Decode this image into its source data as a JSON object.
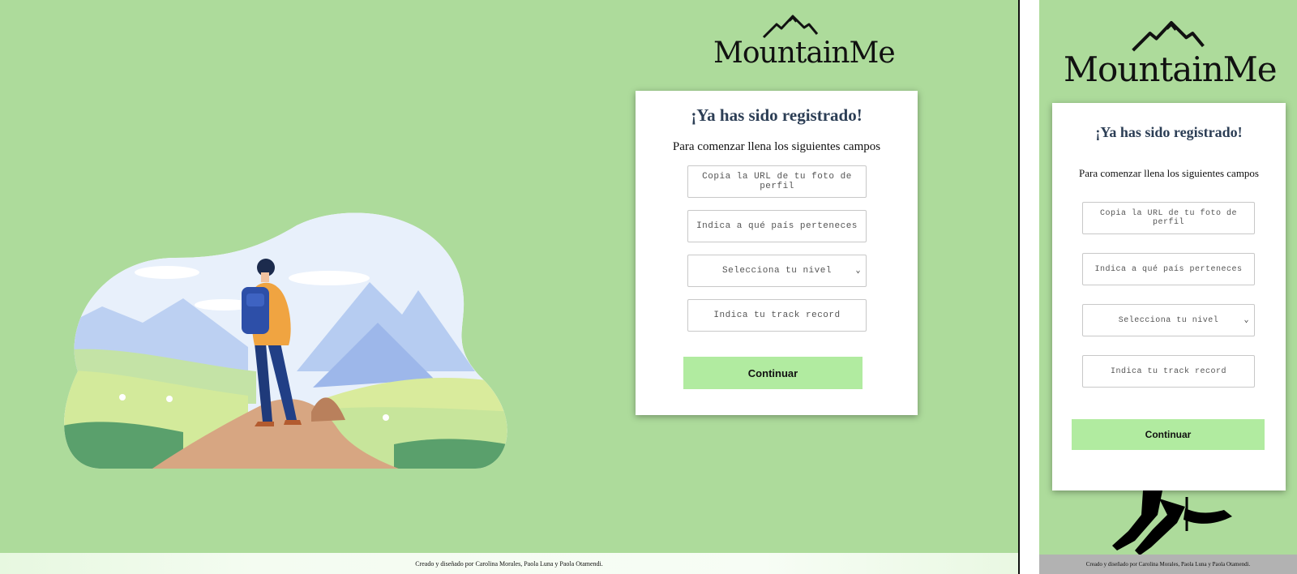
{
  "brand": {
    "name": "MountainMe",
    "logo_icon": "mountain-peaks-icon"
  },
  "card": {
    "title": "¡Ya has sido registrado!",
    "subtitle": "Para comenzar llena los siguientes campos",
    "fields": {
      "photo_url_placeholder": "Copia la URL de tu foto de perfil",
      "country_placeholder": "Indica a qué país perteneces",
      "level_selected": "Selecciona tu nivel",
      "track_record_placeholder": "Indica tu track record"
    },
    "continue_label": "Continuar"
  },
  "footer": {
    "credits": "Creado y diseñado por Carolina Morales, Paola Luna y Paola Otamendi."
  },
  "colors": {
    "background": "#addb9b",
    "button": "#b1eba0",
    "title": "#2c3e55",
    "mobile_footer": "#b2b2b2"
  }
}
